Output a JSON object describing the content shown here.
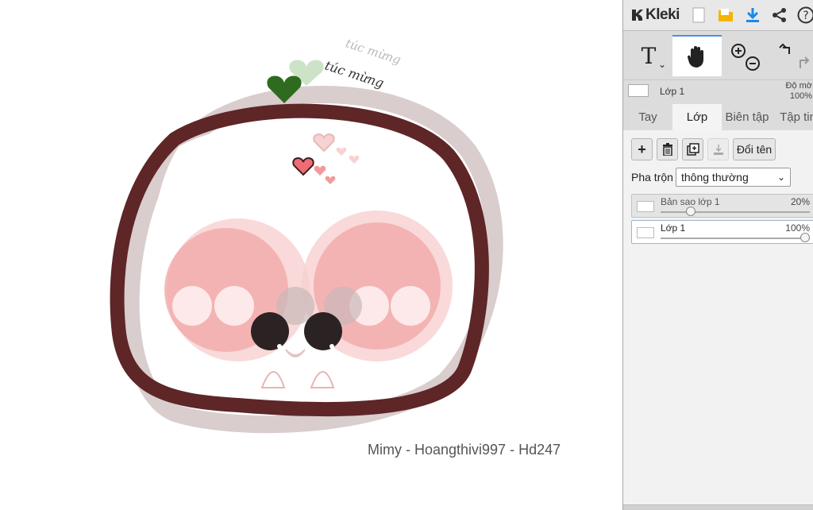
{
  "app": {
    "name": "Kleki"
  },
  "canvas": {
    "watermark": "Mimy - Hoangthivi997 - Hd247",
    "handwriting": "túc mừng"
  },
  "toolbar": {
    "icons": [
      "new-file-icon",
      "folder-icon",
      "download-icon",
      "share-icon",
      "help-icon"
    ],
    "accent": "#1e88e5"
  },
  "tools": {
    "text_tool": "T",
    "active": "hand-tool"
  },
  "layer_info": {
    "name": "Lớp 1",
    "opacity_label": "Độ mờ",
    "opacity_value": "100%"
  },
  "tabs": [
    {
      "label": "Tay",
      "active": false
    },
    {
      "label": "Lớp",
      "active": true
    },
    {
      "label": "Biên tập",
      "active": false
    },
    {
      "label": "Tập tin",
      "active": false
    }
  ],
  "layer_panel": {
    "rename_label": "Đổi tên",
    "blend_label": "Pha trộn",
    "blend_value": "thông thường",
    "layers": [
      {
        "name": "Bản sao lớp 1",
        "opacity": "20%",
        "opacity_fraction": 0.2,
        "selected": false
      },
      {
        "name": "Lớp 1",
        "opacity": "100%",
        "opacity_fraction": 1.0,
        "selected": true
      }
    ]
  }
}
